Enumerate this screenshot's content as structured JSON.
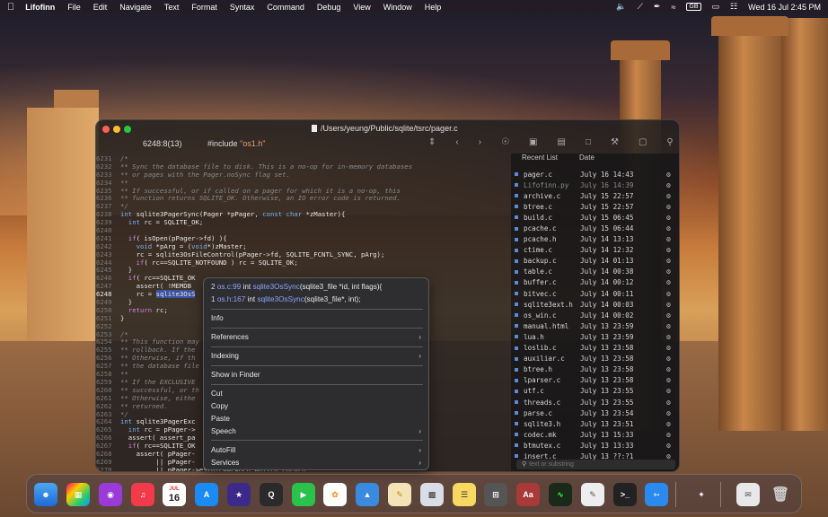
{
  "menubar": {
    "app_name": "Lifofinn",
    "items": [
      "File",
      "Edit",
      "Navigate",
      "Text",
      "Format",
      "Syntax",
      "Command",
      "Debug",
      "View",
      "Window",
      "Help"
    ],
    "input_source": "GB",
    "datetime": "Wed 16 Jul  2:45 PM"
  },
  "window": {
    "title": "/Users/yeung/Public/sqlite/tsrc/pager.c",
    "cursor_position": "6248:8(13)",
    "include_label": "#include ",
    "include_file": "\"os1.h\""
  },
  "code_lines": [
    {
      "n": "6231",
      "t": "/*",
      "cls": "comment"
    },
    {
      "n": "6232",
      "t": "** Sync the database file to disk. This is a no-op for in-memory databases",
      "cls": "comment"
    },
    {
      "n": "6233",
      "t": "** or pages with the Pager.noSync flag set.",
      "cls": "comment"
    },
    {
      "n": "6234",
      "t": "**",
      "cls": "comment"
    },
    {
      "n": "6235",
      "t": "** If successful, or if called on a pager for which it is a no-op, this",
      "cls": "comment"
    },
    {
      "n": "6236",
      "t": "** function returns SQLITE_OK. Otherwise, an IO error code is returned.",
      "cls": "comment"
    },
    {
      "n": "6237",
      "t": "*/",
      "cls": "comment"
    },
    {
      "n": "6238",
      "t": "int sqlite3PagerSync(Pager *pPager, const char *zMaster){",
      "cls": "tx"
    },
    {
      "n": "6239",
      "t": "  int rc = SQLITE_OK;",
      "cls": "tx"
    },
    {
      "n": "6240",
      "t": "",
      "cls": "tx"
    },
    {
      "n": "6241",
      "t": "  if( isOpen(pPager->fd) ){",
      "cls": "tx"
    },
    {
      "n": "6242",
      "t": "    void *pArg = (void*)zMaster;",
      "cls": "tx"
    },
    {
      "n": "6243",
      "t": "    rc = sqlite3OsFileControl(pPager->fd, SQLITE_FCNTL_SYNC, pArg);",
      "cls": "tx"
    },
    {
      "n": "6244",
      "t": "    if( rc==SQLITE_NOTFOUND ) rc = SQLITE_OK;",
      "cls": "tx"
    },
    {
      "n": "6245",
      "t": "  }",
      "cls": "tx"
    },
    {
      "n": "6246",
      "t": "  if( rc==SQLITE_OK",
      "cls": "tx"
    },
    {
      "n": "6247",
      "t": "    assert( !MEMDB",
      "cls": "tx"
    },
    {
      "n": "6248",
      "t": "    rc = sqlite3OsS",
      "cls": "tx"
    },
    {
      "n": "6249",
      "t": "  }",
      "cls": "tx"
    },
    {
      "n": "6250",
      "t": "  return rc;",
      "cls": "tx"
    },
    {
      "n": "6251",
      "t": "}",
      "cls": "tx"
    },
    {
      "n": "6252",
      "t": "",
      "cls": "tx"
    },
    {
      "n": "6253",
      "t": "/*",
      "cls": "comment"
    },
    {
      "n": "6254",
      "t": "** This function may",
      "cls": "comment"
    },
    {
      "n": "6255",
      "t": "** rollback. If the",
      "cls": "comment"
    },
    {
      "n": "6256",
      "t": "** Otherwise, if th",
      "cls": "comment"
    },
    {
      "n": "6257",
      "t": "** the database file",
      "cls": "comment"
    },
    {
      "n": "6258",
      "t": "**",
      "cls": "comment"
    },
    {
      "n": "6259",
      "t": "** If the EXCLUSIVE",
      "cls": "comment"
    },
    {
      "n": "6260",
      "t": "** successful, or th",
      "cls": "comment"
    },
    {
      "n": "6261",
      "t": "** Otherwise, eithe",
      "cls": "comment"
    },
    {
      "n": "6262",
      "t": "** returned.",
      "cls": "comment"
    },
    {
      "n": "6263",
      "t": "*/",
      "cls": "comment"
    },
    {
      "n": "6264",
      "t": "int sqlite3PagerExc",
      "cls": "tx"
    },
    {
      "n": "6265",
      "t": "  int rc = pPager->",
      "cls": "tx"
    },
    {
      "n": "6266",
      "t": "  assert( assert_pa",
      "cls": "tx"
    },
    {
      "n": "6267",
      "t": "  if( rc==SQLITE_OK",
      "cls": "tx"
    },
    {
      "n": "6268",
      "t": "    assert( pPager-",
      "cls": "tx"
    },
    {
      "n": "6269",
      "t": "         || pPager-",
      "cls": "tx"
    },
    {
      "n": "6270",
      "t": "         || pPager->eState==PAGER_WRITER_LOCKED",
      "cls": "tx"
    }
  ],
  "recent": {
    "tab_label": "Recent List",
    "date_header": "Date",
    "search_placeholder": "text or substring",
    "files": [
      {
        "name": "pager.c",
        "date": "July 16 14:43",
        "dim": false
      },
      {
        "name": "Lifofinn.py",
        "date": "July 16 14:39",
        "dim": true
      },
      {
        "name": "archive.c",
        "date": "July 15 22:57",
        "dim": false
      },
      {
        "name": "btree.c",
        "date": "July 15 22:57",
        "dim": false
      },
      {
        "name": "build.c",
        "date": "July 15 06:45",
        "dim": false
      },
      {
        "name": "pcache.c",
        "date": "July 15 06:44",
        "dim": false
      },
      {
        "name": "pcache.h",
        "date": "July 14 13:13",
        "dim": false
      },
      {
        "name": "ctime.c",
        "date": "July 14 12:32",
        "dim": false
      },
      {
        "name": "backup.c",
        "date": "July 14 01:13",
        "dim": false
      },
      {
        "name": "table.c",
        "date": "July 14 00:38",
        "dim": false
      },
      {
        "name": "buffer.c",
        "date": "July 14 00:12",
        "dim": false
      },
      {
        "name": "bitvec.c",
        "date": "July 14 00:11",
        "dim": false
      },
      {
        "name": "sqlite3ext.h",
        "date": "July 14 00:03",
        "dim": false
      },
      {
        "name": "os_win.c",
        "date": "July 14 00:02",
        "dim": false
      },
      {
        "name": "manual.html",
        "date": "July 13 23:59",
        "dim": false
      },
      {
        "name": "lua.h",
        "date": "July 13 23:59",
        "dim": false
      },
      {
        "name": "loslib.c",
        "date": "July 13 23:58",
        "dim": false
      },
      {
        "name": "auxiliar.c",
        "date": "July 13 23:58",
        "dim": false
      },
      {
        "name": "btree.h",
        "date": "July 13 23:58",
        "dim": false
      },
      {
        "name": "lparser.c",
        "date": "July 13 23:58",
        "dim": false
      },
      {
        "name": "utf.c",
        "date": "July 13 23:55",
        "dim": false
      },
      {
        "name": "threads.c",
        "date": "July 13 23:55",
        "dim": false
      },
      {
        "name": "parse.c",
        "date": "July 13 23:54",
        "dim": false
      },
      {
        "name": "sqlite3.h",
        "date": "July 13 23:51",
        "dim": false
      },
      {
        "name": "codec.mk",
        "date": "July 13 15:33",
        "dim": false
      },
      {
        "name": "btmutex.c",
        "date": "July 13 13:33",
        "dim": false
      },
      {
        "name": "insert.c",
        "date": "July 13 ??:?1",
        "dim": false
      }
    ]
  },
  "context_menu": {
    "defs": [
      {
        "num": "2",
        "file": "os.c:99",
        "pre": "int",
        "name": "sqlite3OsSync",
        "args": "(sqlite3_file *id, int flags){"
      },
      {
        "num": "1",
        "file": "os.h:167",
        "pre": "int",
        "name": "sqlite3OsSync",
        "args": "(sqlite3_file*, int);"
      }
    ],
    "info": "Info",
    "references": "References",
    "indexing": "Indexing",
    "show_in_finder": "Show in Finder",
    "cut": "Cut",
    "copy": "Copy",
    "paste": "Paste",
    "speech": "Speech",
    "autofill": "AutoFill",
    "services": "Services"
  },
  "dock": {
    "calendar_month": "JUL",
    "calendar_day": "16"
  },
  "colors": {
    "menubar_bg": "#2a1c24",
    "selection": "#3a52a0",
    "comment": "#8a8a8a",
    "keyword": "#d983e0",
    "type": "#7ab3f0"
  }
}
